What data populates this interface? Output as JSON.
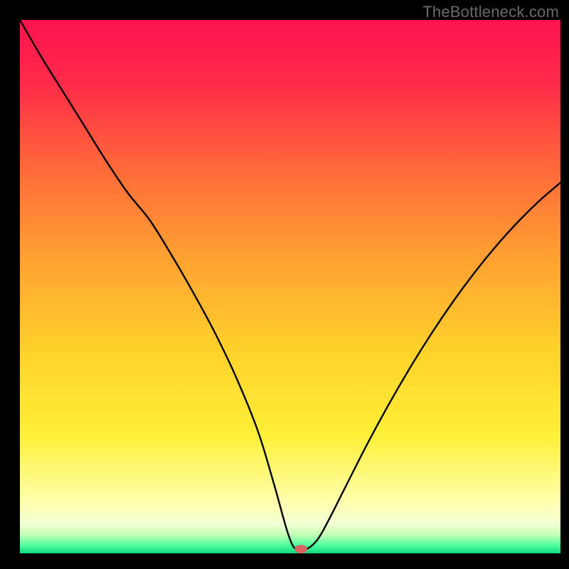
{
  "watermark": "TheBottleneck.com",
  "chart_data": {
    "type": "line",
    "title": "",
    "xlabel": "",
    "ylabel": "",
    "xlim": [
      0,
      100
    ],
    "ylim": [
      0,
      100
    ],
    "grid": false,
    "legend": false,
    "background": {
      "description": "vertical gradient red→orange→yellow→pale-yellow, with thin green band at bottom",
      "stops": [
        {
          "pos": 0.0,
          "color": "#ff1350"
        },
        {
          "pos": 0.12,
          "color": "#ff2b48"
        },
        {
          "pos": 0.28,
          "color": "#ff6a3a"
        },
        {
          "pos": 0.45,
          "color": "#ffa231"
        },
        {
          "pos": 0.62,
          "color": "#ffd22a"
        },
        {
          "pos": 0.78,
          "color": "#fff038"
        },
        {
          "pos": 0.905,
          "color": "#ffffb0"
        },
        {
          "pos": 0.945,
          "color": "#f2ffd4"
        },
        {
          "pos": 0.965,
          "color": "#c3ffb4"
        },
        {
          "pos": 0.985,
          "color": "#4dff9e"
        },
        {
          "pos": 1.0,
          "color": "#10d880"
        }
      ]
    },
    "series": [
      {
        "name": "bottleneck-curve",
        "color": "#000000",
        "stroke_width": 2.4,
        "x": [
          0,
          4,
          8,
          12,
          16,
          20,
          24,
          28,
          32,
          36,
          40,
          44,
          47,
          49.5,
          51,
          53,
          55,
          57,
          60,
          64,
          68,
          72,
          76,
          80,
          84,
          88,
          92,
          96,
          100
        ],
        "y": [
          100,
          93,
          86.5,
          80,
          73.5,
          67.5,
          62.5,
          56,
          49,
          41.5,
          33,
          23,
          13,
          4,
          0.8,
          0.8,
          2.5,
          6,
          12,
          20,
          27.5,
          34.5,
          41,
          47,
          52.5,
          57.5,
          62,
          66,
          69.5
        ]
      }
    ],
    "marker": {
      "name": "optimal-point",
      "x": 52,
      "y": 0.8,
      "color": "#d9635f",
      "rx": 9,
      "ry": 6
    }
  }
}
